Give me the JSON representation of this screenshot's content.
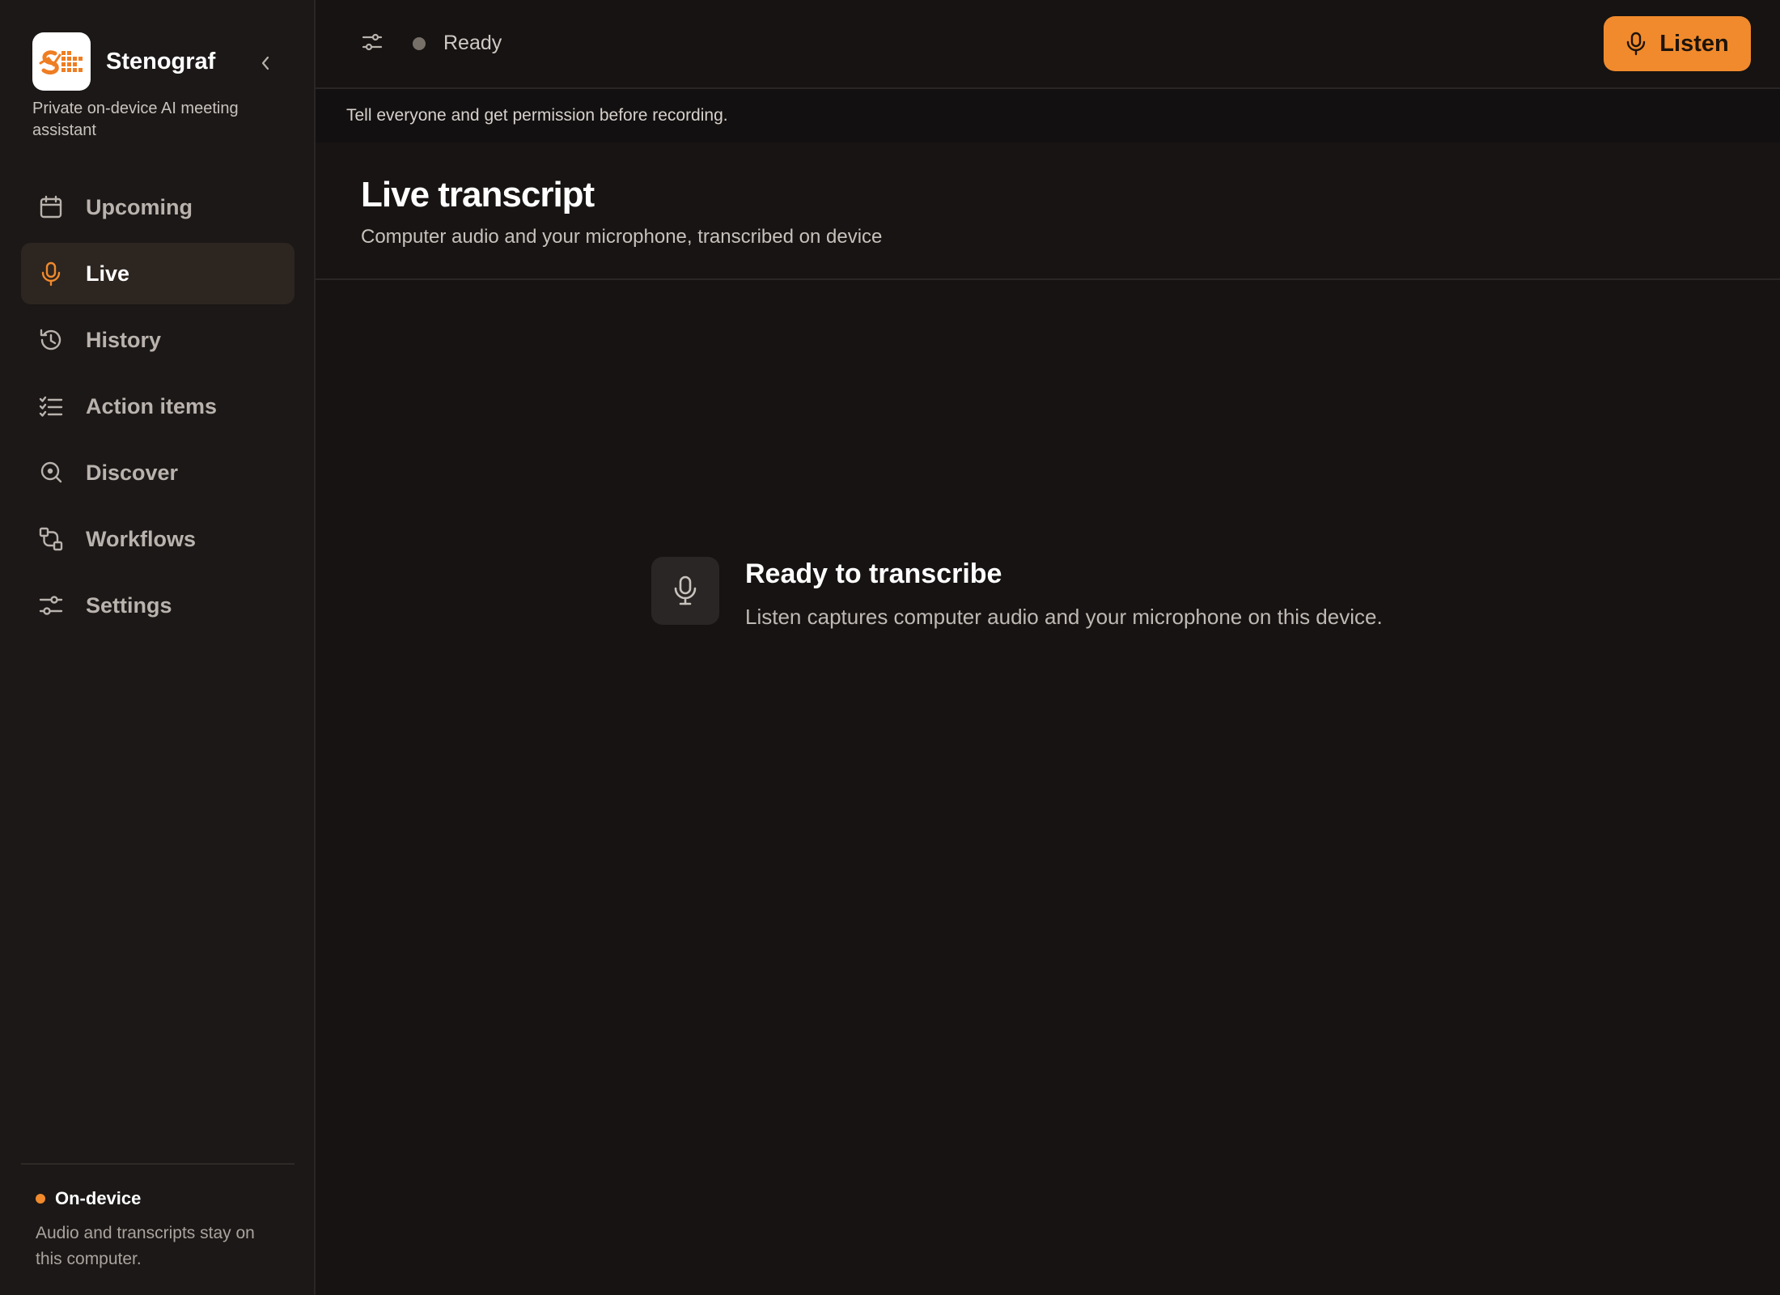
{
  "sidebar": {
    "brand": {
      "name": "Stenograf",
      "tagline": "Private on-device AI meeting assistant"
    },
    "items": [
      {
        "label": "Upcoming",
        "icon": "calendar-icon",
        "active": false
      },
      {
        "label": "Live",
        "icon": "microphone-icon",
        "active": true
      },
      {
        "label": "History",
        "icon": "history-icon",
        "active": false
      },
      {
        "label": "Action items",
        "icon": "checklist-icon",
        "active": false
      },
      {
        "label": "Discover",
        "icon": "search-icon",
        "active": false
      },
      {
        "label": "Workflows",
        "icon": "workflow-icon",
        "active": false
      },
      {
        "label": "Settings",
        "icon": "sliders-icon",
        "active": false
      }
    ],
    "footer": {
      "title": "On-device",
      "text": "Audio and transcripts stay on this computer."
    }
  },
  "topbar": {
    "status": "Ready",
    "listen_label": "Listen"
  },
  "notice": "Tell everyone and get permission before recording.",
  "header": {
    "title": "Live transcript",
    "subtitle": "Computer audio and your microphone, transcribed on device"
  },
  "empty_state": {
    "title": "Ready to transcribe",
    "description": "Listen captures computer audio and your microphone on this device."
  },
  "colors": {
    "accent": "#f08a2c",
    "background": "#161312",
    "sidebar": "#1b1817",
    "active_item": "#2d2520"
  }
}
